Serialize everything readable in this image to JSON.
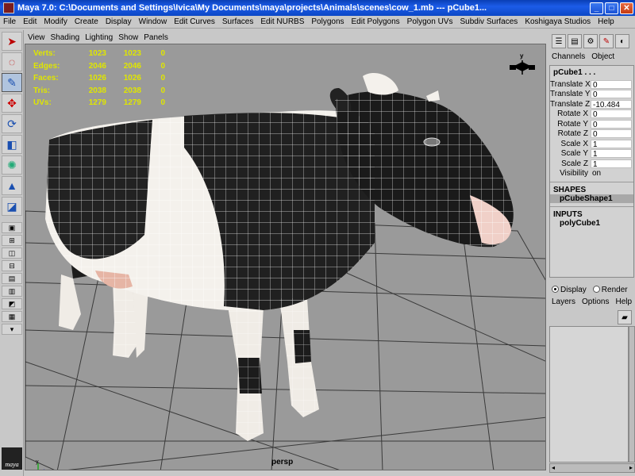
{
  "window": {
    "title": "Maya 7.0: C:\\Documents and Settings\\Ivica\\My Documents\\maya\\projects\\Animals\\scenes\\cow_1.mb   ---   pCube1...",
    "minimize": "_",
    "maximize": "□",
    "close": "✕"
  },
  "menubar": [
    "File",
    "Edit",
    "Modify",
    "Create",
    "Display",
    "Window",
    "Edit Curves",
    "Surfaces",
    "Edit NURBS",
    "Polygons",
    "Edit Polygons",
    "Polygon UVs",
    "Subdiv Surfaces",
    "Koshigaya Studios",
    "Help"
  ],
  "viewport": {
    "menu": [
      "View",
      "Shading",
      "Lighting",
      "Show",
      "Panels"
    ],
    "camera": "persp",
    "hud": [
      {
        "label": "Verts:",
        "a": "1023",
        "b": "1023",
        "c": "0"
      },
      {
        "label": "Edges:",
        "a": "2046",
        "b": "2046",
        "c": "0"
      },
      {
        "label": "Faces:",
        "a": "1026",
        "b": "1026",
        "c": "0"
      },
      {
        "label": "Tris:",
        "a": "2038",
        "b": "2038",
        "c": "0"
      },
      {
        "label": "UVs:",
        "a": "1279",
        "b": "1279",
        "c": "0"
      }
    ],
    "view_cube_label": "y",
    "axis_label": "y",
    "colors": {
      "background": "#9a9a9a",
      "grid": "#3a3a3a",
      "hud": "#dfe600"
    }
  },
  "channel_box": {
    "tabs": [
      "Channels",
      "Object"
    ],
    "object": "pCube1 . . .",
    "attributes": [
      {
        "label": "Translate X",
        "value": "0"
      },
      {
        "label": "Translate Y",
        "value": "0"
      },
      {
        "label": "Translate Z",
        "value": "-10.484"
      },
      {
        "label": "Rotate X",
        "value": "0"
      },
      {
        "label": "Rotate Y",
        "value": "0"
      },
      {
        "label": "Rotate Z",
        "value": "0"
      },
      {
        "label": "Scale X",
        "value": "1"
      },
      {
        "label": "Scale Y",
        "value": "1"
      },
      {
        "label": "Scale Z",
        "value": "1"
      },
      {
        "label": "Visibility",
        "value": "on"
      }
    ],
    "shapes_header": "SHAPES",
    "shape": "pCubeShape1",
    "inputs_header": "INPUTS",
    "input": "polyCube1"
  },
  "layer_editor": {
    "display_radio": "Display",
    "render_radio": "Render",
    "menu": [
      "Layers",
      "Options",
      "Help"
    ]
  },
  "toolbox": {
    "logo": "maya"
  }
}
